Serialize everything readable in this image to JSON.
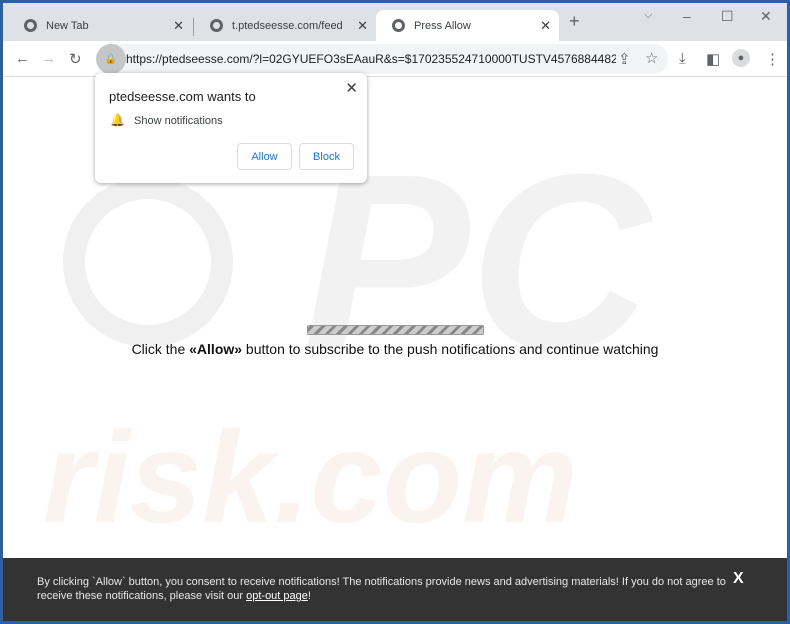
{
  "tabs": [
    {
      "label": "New Tab",
      "icon": "chrome-icon"
    },
    {
      "label": "t.ptedseesse.com/feed",
      "icon": "globe-icon"
    },
    {
      "label": "Press Allow",
      "icon": "globe-icon",
      "active": true
    }
  ],
  "address": {
    "url": "https://ptedseesse.com/?l=02GYUEFO3sEAauR&s=$170235524710000TUSTV45768844824..."
  },
  "popup": {
    "title": "ptedseesse.com wants to",
    "permission": "Show notifications",
    "allow": "Allow",
    "block": "Block"
  },
  "main": {
    "msg_prefix": "Click the ",
    "msg_bold": "«Allow»",
    "msg_suffix": " button to subscribe to the push notifications and continue watching",
    "progress": 0.6
  },
  "watermark": {
    "logo": "PC",
    "text": "risk.com"
  },
  "footer": {
    "text": "By clicking `Allow` button, you consent to receive notifications! The notifications provide news and advertising materials! If you do not agree to receive these notifications, please visit our ",
    "link": "opt-out page",
    "end": "!",
    "close": "X"
  }
}
